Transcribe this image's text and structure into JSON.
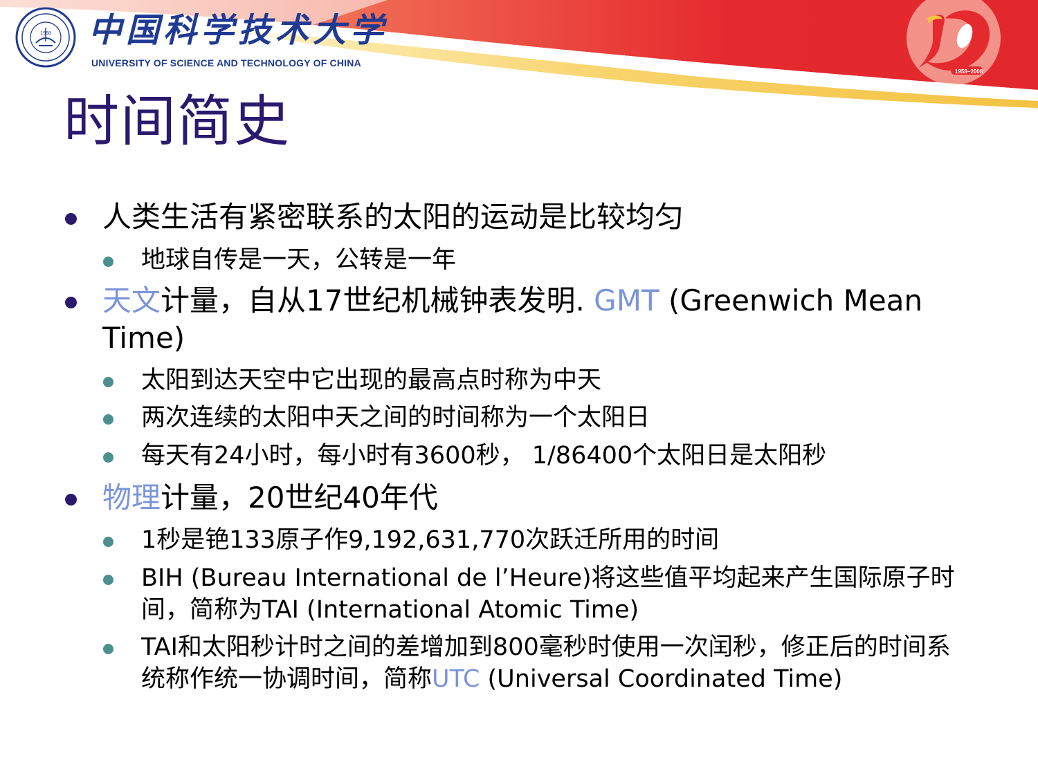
{
  "header": {
    "university_name_cn": "中国科学技术大学",
    "university_name_en": "UNIVERSITY OF SCIENCE AND TECHNOLOGY OF CHINA",
    "seal_icon": "university-seal-icon",
    "seal_year": "1958",
    "anniversary_logo_icon": "anniversary-50-logo-icon",
    "anniversary_years": "1958~2008"
  },
  "slide": {
    "title": "时间简史",
    "b1": {
      "text": "人类生活有紧密联系的太阳的运动是比较均匀",
      "sub1": "地球自传是一天，公转是一年"
    },
    "b2": {
      "accent1": "天文",
      "text1": "计量，自从17世纪机械钟表发明. ",
      "accent2": "GMT",
      "text2": " (Greenwich Mean Time)",
      "sub1": "太阳到达天空中它出现的最高点时称为中天",
      "sub2": "两次连续的太阳中天之间的时间称为一个太阳日",
      "sub3": "每天有24小时，每小时有3600秒， 1/86400个太阳日是太阳秒"
    },
    "b3": {
      "accent1": "物理",
      "text1": "计量，20世纪40年代",
      "sub1": "1秒是铯133原子作9,192,631,770次跃迁所用的时间",
      "sub2": "BIH (Bureau International de l’Heure)将这些值平均起来产生国际原子时间，简称为TAI (International Atomic Time)",
      "sub3_text1": "TAI和太阳秒计时之间的差增加到800毫秒时使用一次闰秒，修正后的时间系统称作统一协调时间，简称",
      "sub3_accent": "UTC",
      "sub3_text2": " (Universal Coordinated Time)"
    }
  },
  "colors": {
    "title": "#2a1a6e",
    "accent": "#7b95d9",
    "bullet_l1": "#2a1a6e",
    "bullet_l2": "#4c8f8f",
    "banner_red": "#e52a2f",
    "banner_gold": "#f6c94a",
    "brand_blue": "#1f3a93"
  }
}
